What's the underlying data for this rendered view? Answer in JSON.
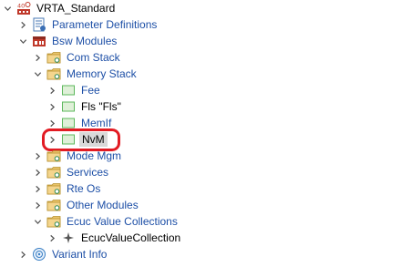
{
  "tree": {
    "root": {
      "label": "VRTA_Standard",
      "icon": "vrta-project-icon",
      "expanded": true
    },
    "items": [
      {
        "label": "Parameter Definitions",
        "icon": "parameter-definitions-icon",
        "expanded": false,
        "color": "#1d4fa6"
      },
      {
        "label": "Bsw Modules",
        "icon": "bsw-modules-icon",
        "expanded": true,
        "color": "#1d4fa6"
      },
      {
        "label": "Com Stack",
        "icon": "folder-icon",
        "expanded": false,
        "color": "#1d4fa6"
      },
      {
        "label": "Memory Stack",
        "icon": "folder-icon",
        "expanded": true,
        "color": "#1d4fa6"
      },
      {
        "label": "Fee",
        "icon": "module-icon",
        "expanded": false,
        "color": "#1d4fa6"
      },
      {
        "label": "Fls \"Fls\"",
        "icon": "module-icon",
        "expanded": false,
        "color": "#000000"
      },
      {
        "label": "MemIf",
        "icon": "module-icon",
        "expanded": false,
        "color": "#1d4fa6"
      },
      {
        "label": "NvM",
        "icon": "module-icon",
        "expanded": false,
        "selected": true,
        "color": "#000000"
      },
      {
        "label": "Mode Mgm",
        "icon": "folder-icon",
        "expanded": false,
        "color": "#1d4fa6"
      },
      {
        "label": "Services",
        "icon": "folder-icon",
        "expanded": false,
        "color": "#1d4fa6"
      },
      {
        "label": "Rte Os",
        "icon": "folder-icon",
        "expanded": false,
        "color": "#1d4fa6"
      },
      {
        "label": "Other Modules",
        "icon": "folder-icon",
        "expanded": false,
        "color": "#1d4fa6"
      },
      {
        "label": "Ecuc Value Collections",
        "icon": "folder-icon",
        "expanded": true,
        "color": "#1d4fa6"
      },
      {
        "label": "EcucValueCollection",
        "icon": "ecuc-value-collection-icon",
        "expanded": false,
        "color": "#000000"
      },
      {
        "label": "Variant Info",
        "icon": "variant-info-icon",
        "expanded": false,
        "color": "#1d4fa6"
      }
    ]
  },
  "colors": {
    "link_blue": "#1d4fa6",
    "folder_yellow": "#e9c46a",
    "module_green": "#5cb85c",
    "highlight_red": "#e21b23",
    "selection_gray": "#d9d9d9"
  }
}
